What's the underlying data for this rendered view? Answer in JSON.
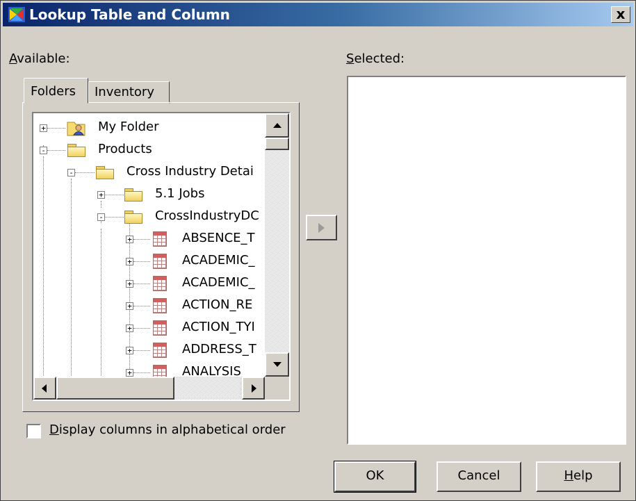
{
  "window": {
    "title": "Lookup Table and Column",
    "close_label": "x"
  },
  "available_label": {
    "accel": "A",
    "rest": "vailable:"
  },
  "selected_label": {
    "accel": "S",
    "rest": "elected:"
  },
  "tabs": [
    {
      "label": "Folders",
      "active": true
    },
    {
      "label": "Inventory",
      "active": false
    }
  ],
  "tree": [
    {
      "label": "My Folder",
      "icon": "user-folder-icon",
      "expander": "+",
      "level": 0
    },
    {
      "label": "Products",
      "icon": "folder-icon",
      "expander": "-",
      "level": 0
    },
    {
      "label": "Cross Industry Detai",
      "icon": "folder-icon",
      "expander": "-",
      "level": 1
    },
    {
      "label": "5.1 Jobs",
      "icon": "folder-icon",
      "expander": "+",
      "level": 2
    },
    {
      "label": "CrossIndustryDC",
      "icon": "folder-icon",
      "expander": "-",
      "level": 2
    },
    {
      "label": "ABSENCE_T",
      "icon": "table-icon",
      "expander": "+",
      "level": 3
    },
    {
      "label": "ACADEMIC_",
      "icon": "table-icon",
      "expander": "+",
      "level": 3
    },
    {
      "label": "ACADEMIC_",
      "icon": "table-icon",
      "expander": "+",
      "level": 3
    },
    {
      "label": "ACTION_RE",
      "icon": "table-icon",
      "expander": "+",
      "level": 3
    },
    {
      "label": "ACTION_TYI",
      "icon": "table-icon",
      "expander": "+",
      "level": 3
    },
    {
      "label": "ADDRESS_T",
      "icon": "table-icon",
      "expander": "+",
      "level": 3
    },
    {
      "label": "ANALYSIS",
      "icon": "table-icon",
      "expander": "+",
      "level": 3
    }
  ],
  "checkbox": {
    "accel": "D",
    "rest": "isplay columns in alphabetical order",
    "checked": false
  },
  "buttons": {
    "ok": "OK",
    "cancel": "Cancel",
    "help_accel": "H",
    "help_rest": "elp"
  },
  "colors": {
    "titlebar_start": "#0a246a",
    "titlebar_end": "#a6caf0",
    "face": "#d4d0c8"
  }
}
